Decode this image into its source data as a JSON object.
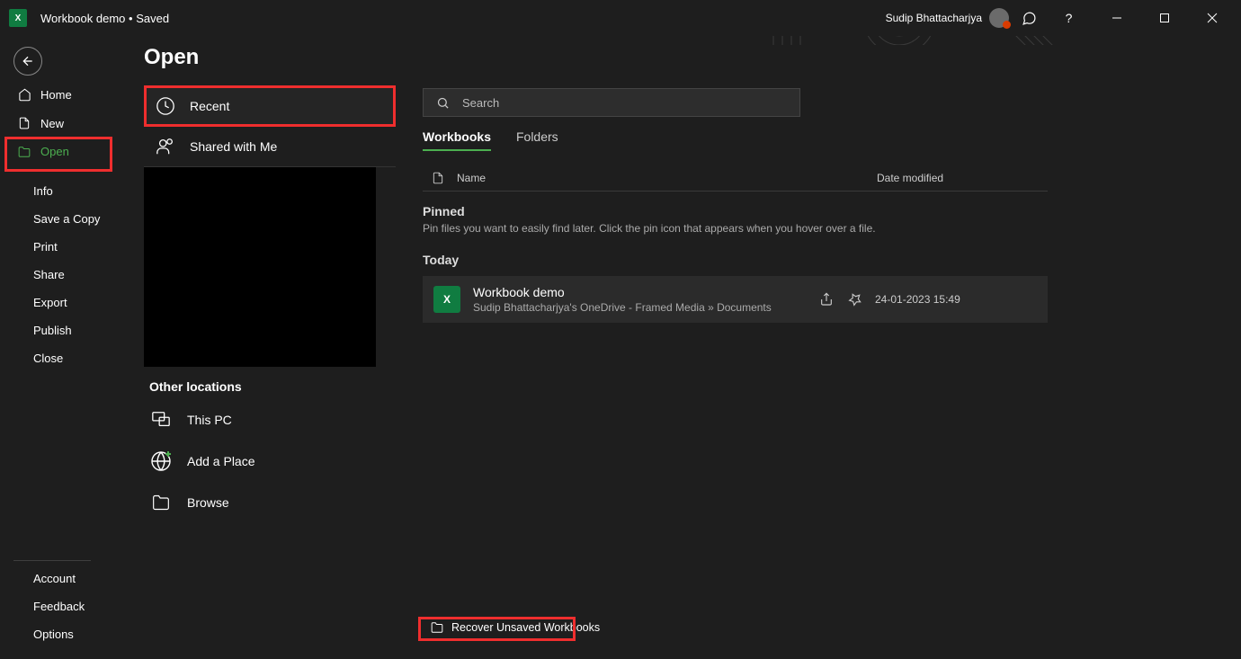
{
  "titlebar": {
    "title": "Workbook demo  •  Saved",
    "username": "Sudip Bhattacharjya"
  },
  "page": {
    "title": "Open"
  },
  "sidebar": {
    "home": "Home",
    "new": "New",
    "open": "Open",
    "info": "Info",
    "save_copy": "Save a Copy",
    "print": "Print",
    "share": "Share",
    "export": "Export",
    "publish": "Publish",
    "close": "Close",
    "account": "Account",
    "feedback": "Feedback",
    "options": "Options"
  },
  "locations": {
    "recent": "Recent",
    "shared": "Shared with Me",
    "other_heading": "Other locations",
    "this_pc": "This PC",
    "add_place": "Add a Place",
    "browse": "Browse"
  },
  "search": {
    "placeholder": "Search"
  },
  "tabs": {
    "workbooks": "Workbooks",
    "folders": "Folders"
  },
  "table": {
    "name_col": "Name",
    "date_col": "Date modified"
  },
  "groups": {
    "pinned": {
      "label": "Pinned",
      "hint": "Pin files you want to easily find later. Click the pin icon that appears when you hover over a file."
    },
    "today": {
      "label": "Today"
    }
  },
  "files": [
    {
      "title": "Workbook demo",
      "path": "Sudip Bhattacharjya's OneDrive - Framed Media » Documents",
      "date": "24-01-2023 15:49"
    }
  ],
  "footer": {
    "recover": "Recover Unsaved Workbooks"
  }
}
